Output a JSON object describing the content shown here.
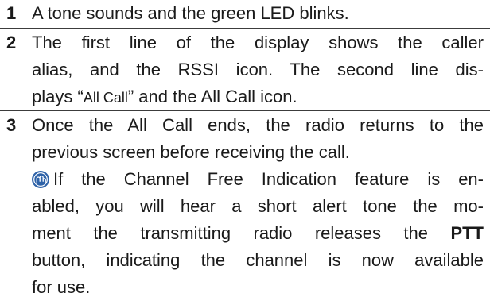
{
  "steps": [
    {
      "number": "1",
      "lines": [
        "A tone sounds and the green LED blinks."
      ]
    },
    {
      "number": "2",
      "lines": [
        "The first line of the display shows the caller",
        "alias, and the RSSI icon. The second line dis-",
        "plays ",
        "All Call",
        " and the All Call icon."
      ]
    },
    {
      "number": "3",
      "lines": [
        "Once the All Call ends, the radio returns to the",
        "previous screen before receiving the call."
      ],
      "note": {
        "icon": "note-icon",
        "line1": "If the Channel Free Indication feature is en-",
        "line2": "abled, you will hear a short alert tone the mo-",
        "line3_pre": "ment the transmitting radio releases the ",
        "line3_bold": "PTT",
        "line4": "button, indicating the channel is now available",
        "line5": "for use."
      }
    }
  ],
  "colors": {
    "text": "#1a1a1a",
    "rule": "#3c3c3c",
    "note_icon": "#2e62a8"
  }
}
